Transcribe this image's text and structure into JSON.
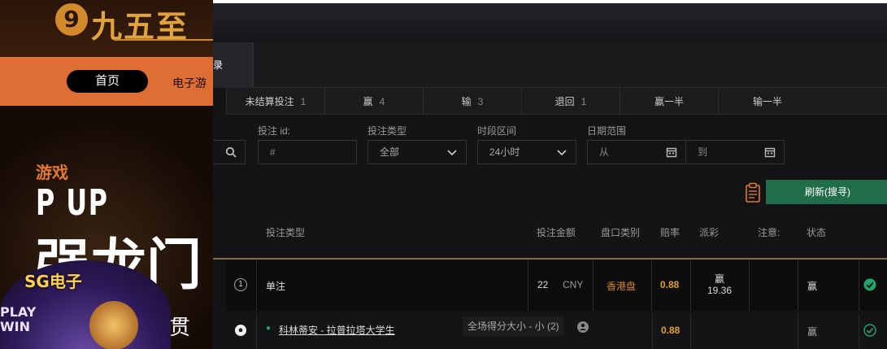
{
  "site": {
    "logo_text": "九五至",
    "nav": {
      "home": "首页",
      "slots": "电子游"
    },
    "banner": {
      "tag": "游戏",
      "headline": "P UP",
      "title": "强龙门",
      "side_char": "贯",
      "sg_label": "SG电子",
      "play_win": "PLAY\nWIN"
    }
  },
  "modal": {
    "active_tab": "录",
    "filter_tabs": [
      {
        "label": "未结算投注",
        "count": "1"
      },
      {
        "label": "赢",
        "count": "4"
      },
      {
        "label": "输",
        "count": "3"
      },
      {
        "label": "退回",
        "count": "1"
      },
      {
        "label": "赢一半",
        "count": ""
      },
      {
        "label": "输一半",
        "count": ""
      }
    ],
    "filters": {
      "bet_id_label": "投注 id:",
      "bet_id_placeholder": "#",
      "bet_type_label": "投注类型",
      "bet_type_value": "全部",
      "period_label": "时段区间",
      "period_value": "24小时",
      "date_range_label": "日期范围",
      "date_from_placeholder": "从",
      "date_to_placeholder": "到"
    },
    "refresh_button": "刷新(搜寻)",
    "columns": {
      "bet_type": "投注类型",
      "amount": "投注金额",
      "odds_type": "盘口类别",
      "odds": "赔率",
      "payout": "派彩",
      "note": "注意:",
      "status": "状态"
    },
    "rows": [
      {
        "index": "1",
        "bet_type": "单注",
        "amount": "22",
        "currency": "CNY",
        "odds_type": "香港盘",
        "odds": "0.88",
        "payout_label": "赢",
        "payout_value": "19.36",
        "status": "赢"
      },
      {
        "match": "科林蒂安 - 拉普拉塔大学生",
        "market": "全场得分大小 - 小 (2)",
        "odds": "0.88",
        "status": "赢"
      }
    ]
  }
}
